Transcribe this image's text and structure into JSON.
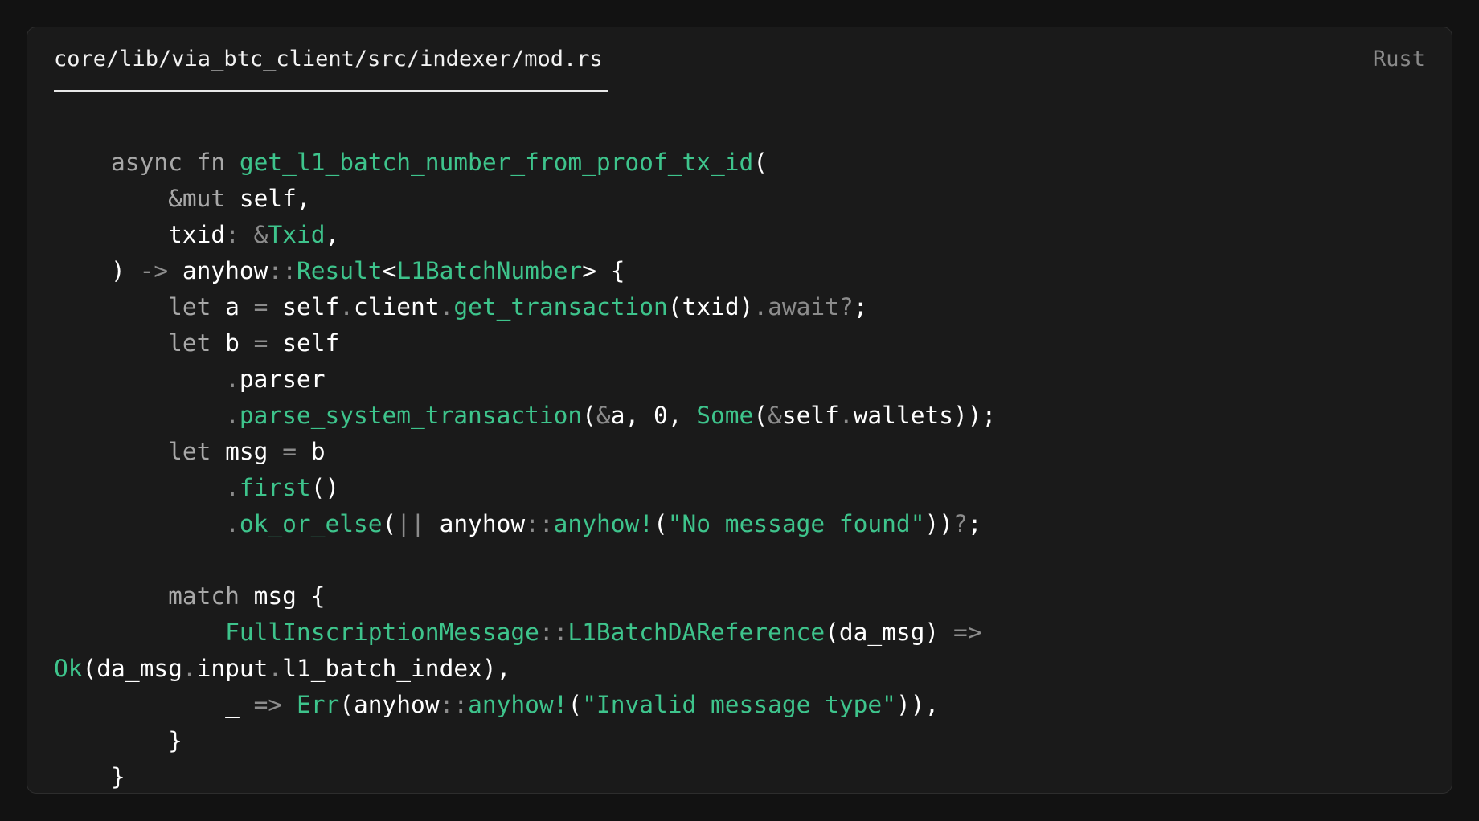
{
  "header": {
    "file_path": "core/lib/via_btc_client/src/indexer/mod.rs",
    "language": "Rust"
  },
  "colors": {
    "background": "#121212",
    "panel": "#1a1a1a",
    "keyword": "#a8a8a8",
    "function": "#3ec48c",
    "punctuation": "#8c8c8c",
    "identifier": "#ffffff"
  },
  "code": {
    "lines": [
      [
        [
          "k",
          "    async fn "
        ],
        [
          "f",
          "get_l1_batch_number_from_proof_tx_id"
        ],
        [
          "w",
          "("
        ]
      ],
      [
        [
          "k",
          "        &mut "
        ],
        [
          "w",
          "self,"
        ]
      ],
      [
        [
          "w",
          "        txid"
        ],
        [
          "p",
          ": &"
        ],
        [
          "f",
          "Txid"
        ],
        [
          "w",
          ","
        ]
      ],
      [
        [
          "w",
          "    ) "
        ],
        [
          "p",
          "-> "
        ],
        [
          "w",
          "anyhow"
        ],
        [
          "p",
          "::"
        ],
        [
          "f",
          "Result"
        ],
        [
          "w",
          "<"
        ],
        [
          "f",
          "L1BatchNumber"
        ],
        [
          "w",
          "> {"
        ]
      ],
      [
        [
          "k",
          "        let "
        ],
        [
          "w",
          "a "
        ],
        [
          "p",
          "= "
        ],
        [
          "w",
          "self"
        ],
        [
          "p",
          "."
        ],
        [
          "w",
          "client"
        ],
        [
          "p",
          "."
        ],
        [
          "f",
          "get_transaction"
        ],
        [
          "w",
          "(txid)"
        ],
        [
          "p",
          ".await?"
        ],
        [
          "w",
          ";"
        ]
      ],
      [
        [
          "k",
          "        let "
        ],
        [
          "w",
          "b "
        ],
        [
          "p",
          "= "
        ],
        [
          "w",
          "self"
        ]
      ],
      [
        [
          "p",
          "            ."
        ],
        [
          "w",
          "parser"
        ]
      ],
      [
        [
          "p",
          "            ."
        ],
        [
          "f",
          "parse_system_transaction"
        ],
        [
          "w",
          "("
        ],
        [
          "p",
          "&"
        ],
        [
          "w",
          "a, 0, "
        ],
        [
          "f",
          "Some"
        ],
        [
          "w",
          "("
        ],
        [
          "p",
          "&"
        ],
        [
          "w",
          "self"
        ],
        [
          "p",
          "."
        ],
        [
          "w",
          "wallets));"
        ]
      ],
      [
        [
          "k",
          "        let "
        ],
        [
          "w",
          "msg "
        ],
        [
          "p",
          "= "
        ],
        [
          "w",
          "b"
        ]
      ],
      [
        [
          "p",
          "            ."
        ],
        [
          "f",
          "first"
        ],
        [
          "w",
          "()"
        ]
      ],
      [
        [
          "p",
          "            ."
        ],
        [
          "f",
          "ok_or_else"
        ],
        [
          "w",
          "("
        ],
        [
          "p",
          "|| "
        ],
        [
          "w",
          "anyhow"
        ],
        [
          "p",
          "::"
        ],
        [
          "f",
          "anyhow!"
        ],
        [
          "w",
          "("
        ],
        [
          "f",
          "\"No message found\""
        ],
        [
          "w",
          "))"
        ],
        [
          "p",
          "?"
        ],
        [
          "w",
          ";"
        ]
      ],
      [
        [
          "w",
          ""
        ]
      ],
      [
        [
          "k",
          "        match "
        ],
        [
          "w",
          "msg {"
        ]
      ],
      [
        [
          "f",
          "            FullInscriptionMessage"
        ],
        [
          "p",
          "::"
        ],
        [
          "f",
          "L1BatchDAReference"
        ],
        [
          "w",
          "(da_msg) "
        ],
        [
          "p",
          "=>"
        ]
      ],
      [
        [
          "f",
          "Ok"
        ],
        [
          "w",
          "(da_msg"
        ],
        [
          "p",
          "."
        ],
        [
          "w",
          "input"
        ],
        [
          "p",
          "."
        ],
        [
          "w",
          "l1_batch_index),"
        ]
      ],
      [
        [
          "w",
          "            _ "
        ],
        [
          "p",
          "=> "
        ],
        [
          "f",
          "Err"
        ],
        [
          "w",
          "(anyhow"
        ],
        [
          "p",
          "::"
        ],
        [
          "f",
          "anyhow!"
        ],
        [
          "w",
          "("
        ],
        [
          "f",
          "\"Invalid message type\""
        ],
        [
          "w",
          ")),"
        ]
      ],
      [
        [
          "w",
          "        }"
        ]
      ],
      [
        [
          "w",
          "    }"
        ]
      ]
    ]
  }
}
